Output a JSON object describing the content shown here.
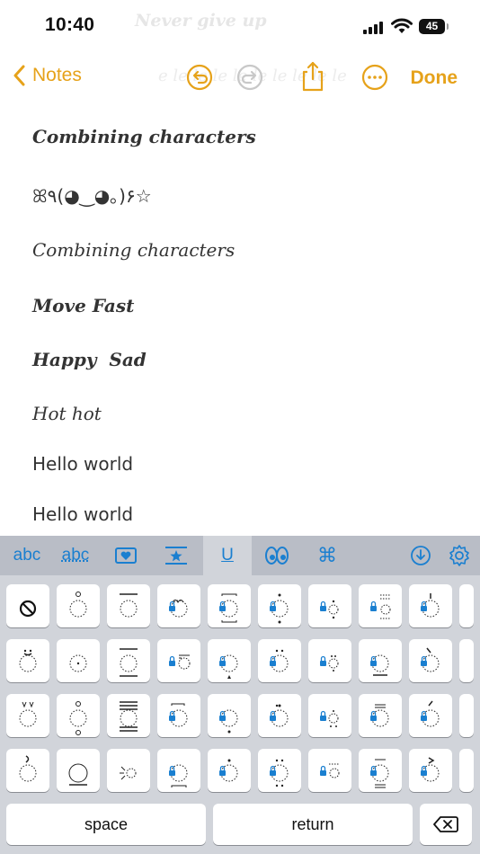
{
  "status": {
    "time": "10:40",
    "battery": "45",
    "ghost_text": "Never give up"
  },
  "nav": {
    "back_label": "Notes",
    "done_label": "Done",
    "ghost_text": "e le le le le le le le le le"
  },
  "note": {
    "lines": [
      "Combining characters",
      "ꕤ٩(◕‿◕｡)۶☆",
      "Combining characters",
      "Move Fast",
      "Happy  Sad",
      "Hot hot",
      "Hello world",
      "Hello world"
    ]
  },
  "keyboard": {
    "tabs": [
      "abc",
      "abc",
      "heart-card-icon",
      "star-card-icon",
      "U",
      "eyes-icon",
      "command-icon"
    ],
    "right_tabs": [
      "download-icon",
      "gear-icon"
    ],
    "space_label": "space",
    "return_label": "return",
    "accent_color": "#1a7fd0"
  }
}
